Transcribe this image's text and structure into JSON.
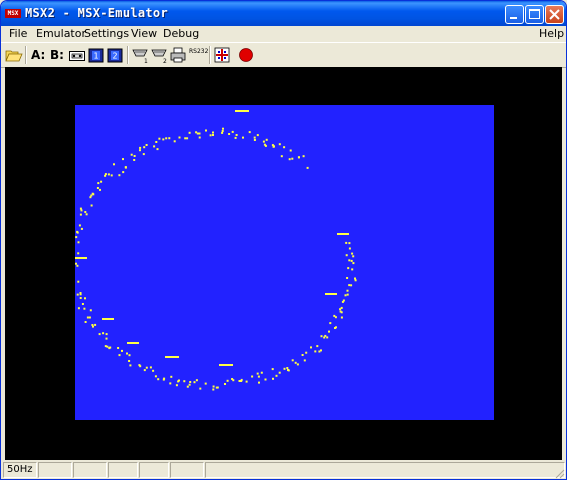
{
  "window": {
    "title": "MSX2 - MSX-Emulator",
    "app_icon_text": "MSX"
  },
  "menu": {
    "file": "File",
    "emulator": "Emulator",
    "settings": "Settings",
    "view": "View",
    "debug": "Debug",
    "help": "Help"
  },
  "toolbar": {
    "drive_a": "A:",
    "drive_b": "B:",
    "rs232_label": "RS232",
    "record_color": "#e00000"
  },
  "display": {
    "background_color": "#2222ff",
    "border_color": "#000000",
    "pixel_color": "#ffff44"
  },
  "status": {
    "refresh_rate": "50Hz"
  }
}
